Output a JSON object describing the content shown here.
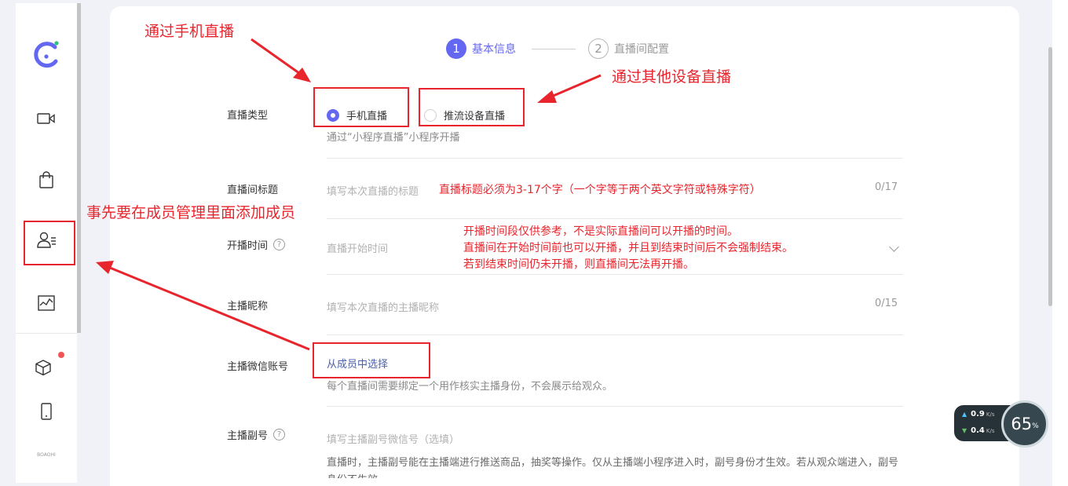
{
  "steps": [
    {
      "number": "1",
      "label": "基本信息"
    },
    {
      "number": "2",
      "label": "直播间配置"
    }
  ],
  "form": {
    "live_type": {
      "label": "直播类型",
      "options": [
        "手机直播",
        "推流设备直播"
      ],
      "selected": "手机直播",
      "hint": "通过“小程序直播”小程序开播"
    },
    "title": {
      "label": "直播间标题",
      "placeholder": "填写本次直播的标题",
      "counter": "0/17"
    },
    "start_time": {
      "label": "开播时间",
      "placeholder": "直播开始时间"
    },
    "anchor_nickname": {
      "label": "主播昵称",
      "placeholder": "填写本次直播的主播昵称",
      "counter": "0/15"
    },
    "anchor_wechat": {
      "label": "主播微信账号",
      "link": "从成员中选择",
      "hint": "每个直播间需要绑定一个用作核实主播身份，不会展示给观众。"
    },
    "anchor_deputy": {
      "label": "主播副号",
      "placeholder": "填写主播副号微信号（选填）",
      "hint": "直播时，主播副号能在主播端进行推送商品，抽奖等操作。仅从主播端小程序进入时，副号身份才生效。若从观众端进入，副号身份不生效。"
    }
  },
  "annotations": {
    "phone_live": "通过手机直播",
    "other_device": "通过其他设备直播",
    "title_rule": "直播标题必须为3-17个字（一个字等于两个英文字符或特殊字符）",
    "members": "事先要在成员管理里面添加成员",
    "time_note": [
      "开播时间段仅供参考，不是实际直播间可以开播的时间。",
      "直播间在开始时间前也可以开播，并且到结束时间后不会强制结束。",
      "若到结束时间仍未开播，则直播间无法再开播。"
    ]
  },
  "speed_widget": {
    "up": "0.9",
    "down": "0.4",
    "unit": "K/s",
    "percent": "65",
    "percent_sign": "%"
  },
  "sidebar": {
    "icons": [
      "logo-icon",
      "video-icon",
      "shopping-bag-icon",
      "member-icon",
      "chart-icon",
      "cube-icon",
      "phone-icon"
    ],
    "brand": "BOAOHI"
  },
  "colors": {
    "accent": "#6467f0",
    "annotation": "#e8252d",
    "link": "#4a5fa8"
  }
}
